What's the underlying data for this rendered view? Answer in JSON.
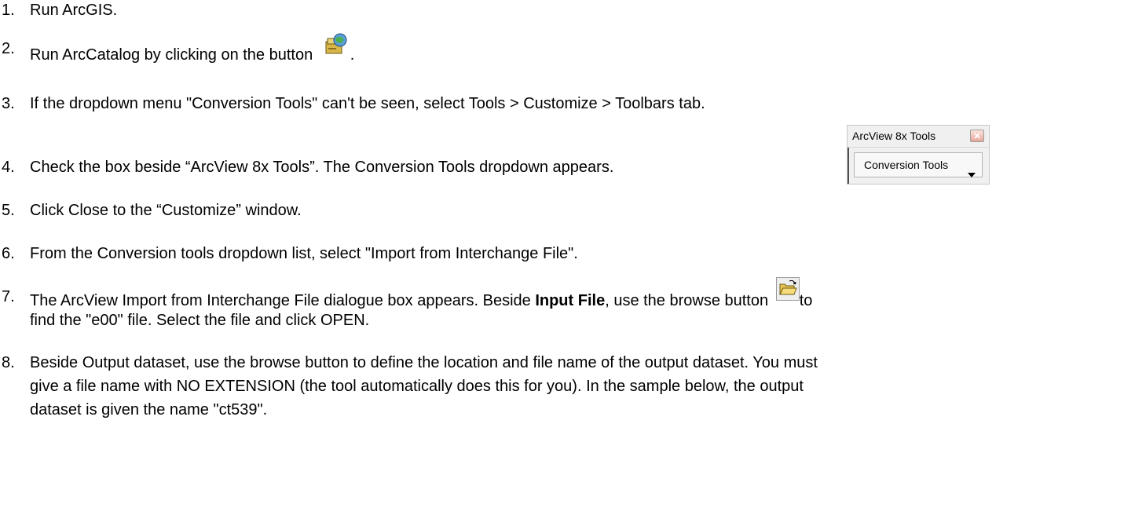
{
  "steps": [
    {
      "num": "1.",
      "text": "Run ArcGIS."
    },
    {
      "num": "2.",
      "text_before": "Run ArcCatalog by clicking on the button",
      "text_after": "."
    },
    {
      "num": "3.",
      "text": "If the dropdown menu \"Conversion Tools\" can't be seen, select Tools > Customize > Toolbars tab."
    },
    {
      "num": "4.",
      "text": "Check the box beside “ArcView 8x Tools”. The Conversion Tools dropdown appears."
    },
    {
      "num": "5.",
      "text": "Click Close to the “Customize” window."
    },
    {
      "num": "6.",
      "text": "From the Conversion tools dropdown list, select \"Import from Interchange File\"."
    },
    {
      "num": "7.",
      "text_a": "The ArcView Import from Interchange File dialogue box appears. Beside ",
      "bold": "Input File",
      "text_b": ", use the browse button",
      "text_c": "to",
      "line2": "find the \"e00\" file. Select the file and click OPEN."
    },
    {
      "num": "8.",
      "line1": "Beside Output dataset, use the browse button to define the location and file name of the output dataset. You must",
      "line2": "give a file name with NO EXTENSION (the tool automatically does this for you). In the sample below, the output",
      "line3": "dataset is given the name \"ct539\"."
    }
  ],
  "toolbar": {
    "title": "ArcView 8x Tools",
    "dropdown_label": "Conversion Tools",
    "close_icon": "close-icon",
    "arrow_icon": "chevron-down-icon"
  },
  "icons": {
    "arccatalog": "arccatalog-icon",
    "browse": "open-folder-icon"
  }
}
